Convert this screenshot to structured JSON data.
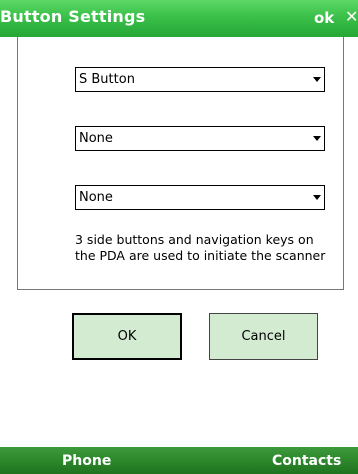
{
  "titlebar": {
    "title": "Button Settings",
    "ok_label": "ok",
    "close_glyph": "✕",
    "close_icon": "close-icon",
    "color": "#3bc04a"
  },
  "settings": {
    "combos": [
      {
        "value": "S Button"
      },
      {
        "value": "None"
      },
      {
        "value": "None"
      }
    ],
    "description": "3 side buttons and navigation keys on the PDA  are used to initiate the scanner"
  },
  "buttons": {
    "ok_label": "OK",
    "cancel_label": "Cancel",
    "fill_color": "#d3ecd1"
  },
  "softkeys": {
    "left_label": "Phone",
    "right_label": "Contacts",
    "color": "#2a8329"
  }
}
